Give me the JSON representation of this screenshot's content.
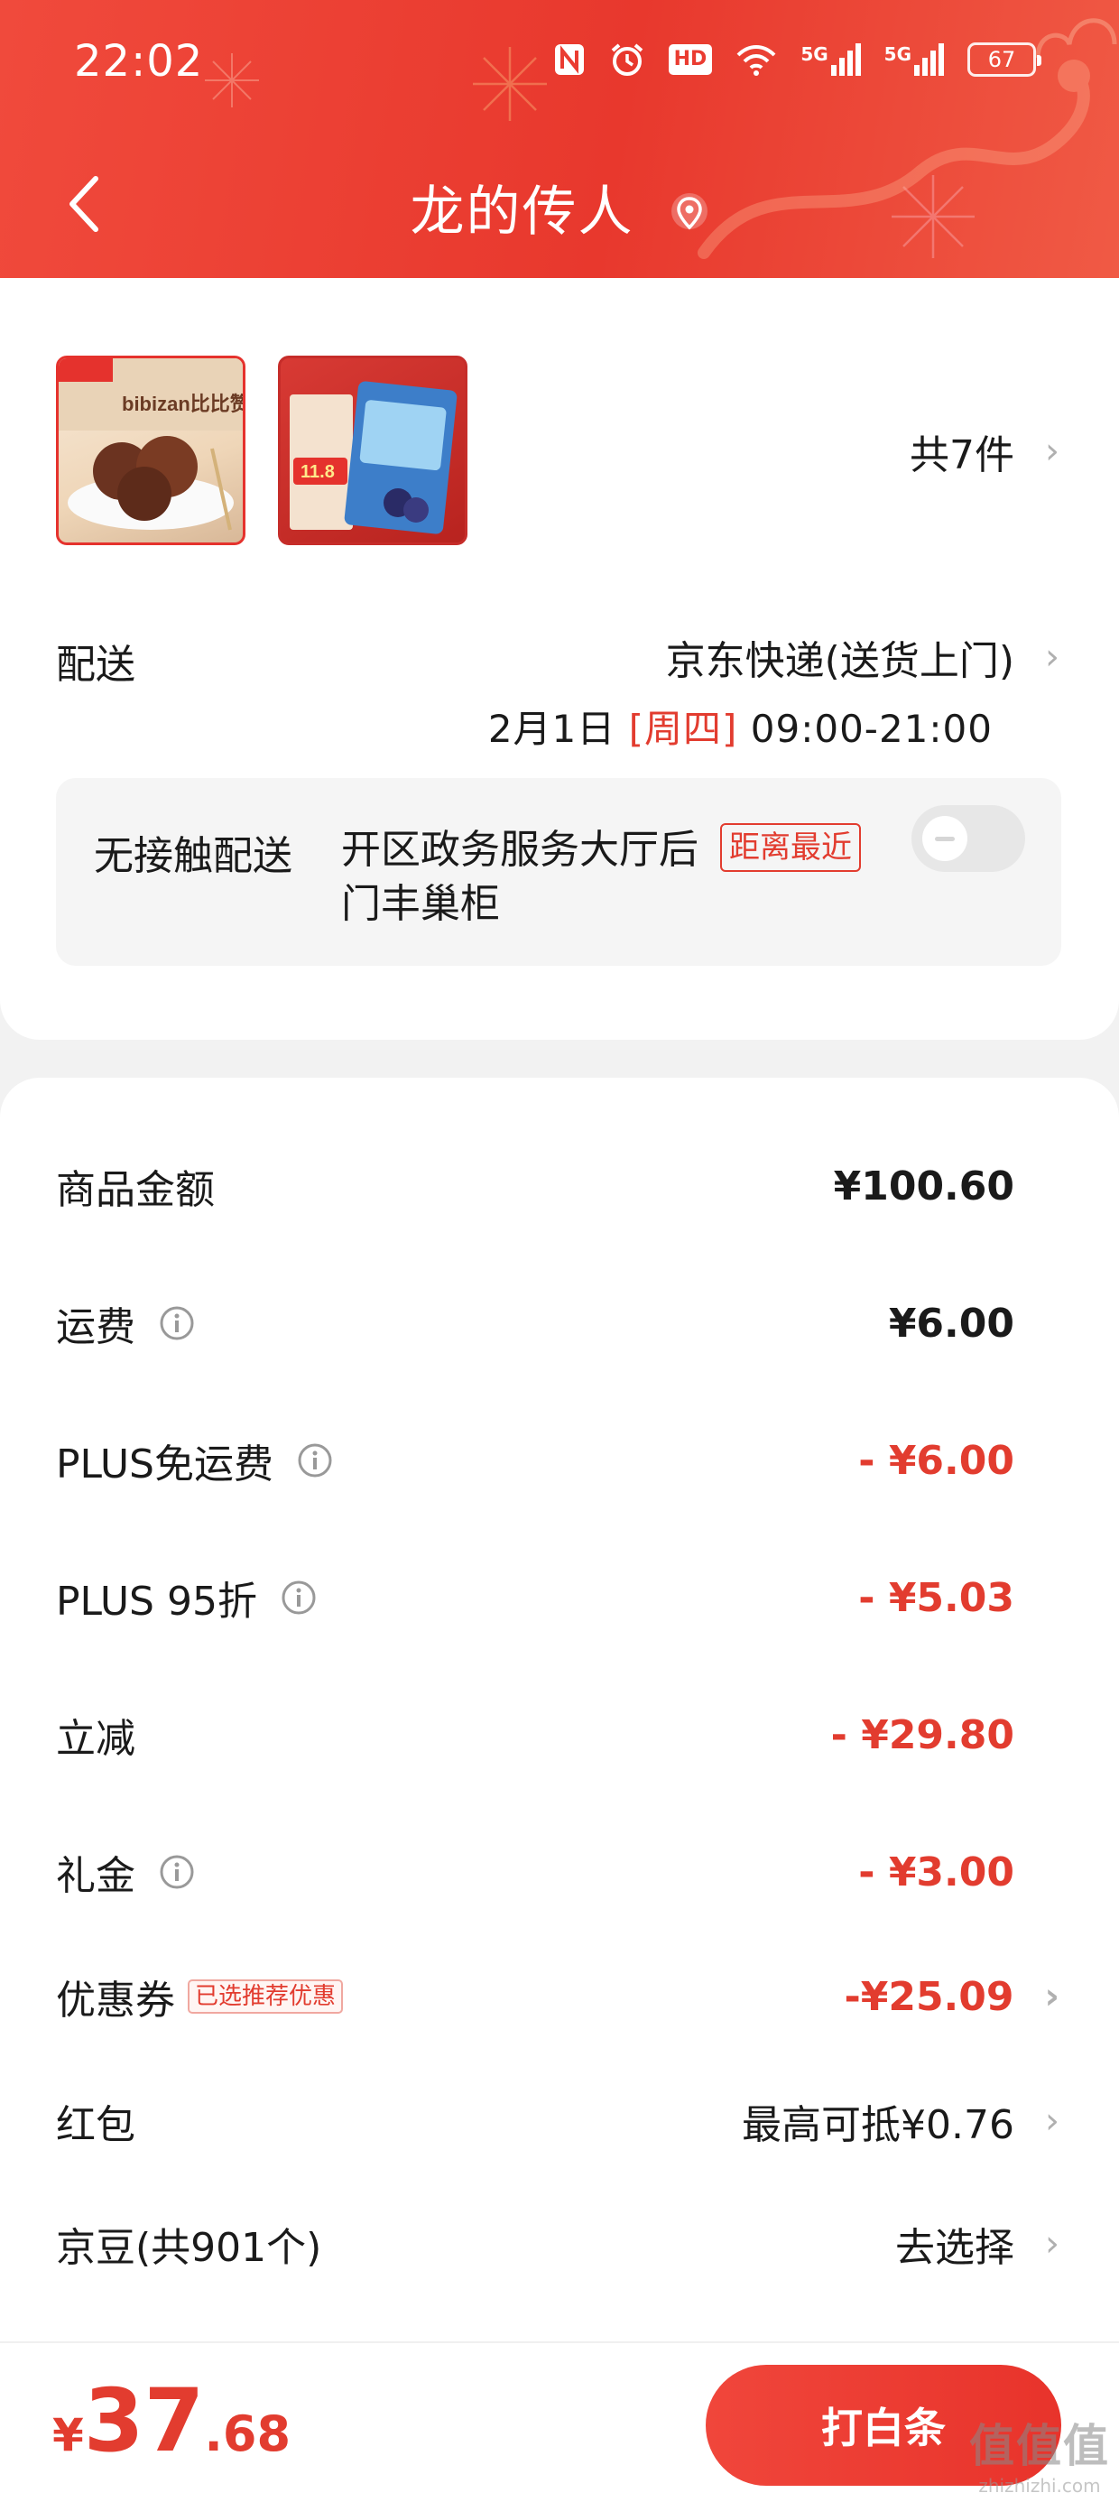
{
  "status_bar": {
    "time": "22:02",
    "icons": [
      "nfc-icon",
      "alarm-icon",
      "hd-icon",
      "wifi-icon",
      "signal-5g-icon",
      "signal-5g-icon"
    ],
    "hd_label": "HD",
    "signal_label": "5G",
    "battery": "67"
  },
  "header": {
    "title": "龙的传人",
    "back_icon": "chevron-left-icon",
    "location_icon": "location-pin-icon"
  },
  "items": {
    "count_label": "共7件",
    "thumb1_brand": "bibizan比比赞",
    "thumb2_price": "11.8"
  },
  "delivery": {
    "label": "配送",
    "method": "京东快递(送货上门)",
    "date": "2月1日",
    "weekday": "[周四]",
    "time_range": "09:00-21:00"
  },
  "contactless": {
    "label": "无接触配送",
    "address": "开区政务服务大厅后门丰巢柜",
    "tag": "距离最近",
    "enabled": false
  },
  "summary": {
    "rows": [
      {
        "label": "商品金额",
        "value": "¥100.60",
        "info": false
      },
      {
        "label": "运费",
        "value": "¥6.00",
        "info": true
      },
      {
        "label": "PLUS免运费",
        "value": "- ¥6.00",
        "info": true
      },
      {
        "label": "PLUS 95折",
        "value": "- ¥5.03",
        "info": true
      },
      {
        "label": "立减",
        "value": "- ¥29.80",
        "info": false
      },
      {
        "label": "礼金",
        "value": "- ¥3.00",
        "info": true
      }
    ],
    "coupon": {
      "label": "优惠券",
      "tag": "已选推荐优惠",
      "value": "-¥25.09"
    },
    "red_packet": {
      "label": "红包",
      "value": "最高可抵¥0.76"
    },
    "jd_beans": {
      "label": "京豆(共901个)",
      "value": "去选择"
    }
  },
  "footer": {
    "currency": "¥",
    "total_int": "37",
    "total_dec": ".68",
    "pay_button": "打白条",
    "watermark": "值值值",
    "watermark_sub": "zhizhizhi.com"
  },
  "colors": {
    "accent": "#e23c2f",
    "header_red": "#ea3c31"
  }
}
